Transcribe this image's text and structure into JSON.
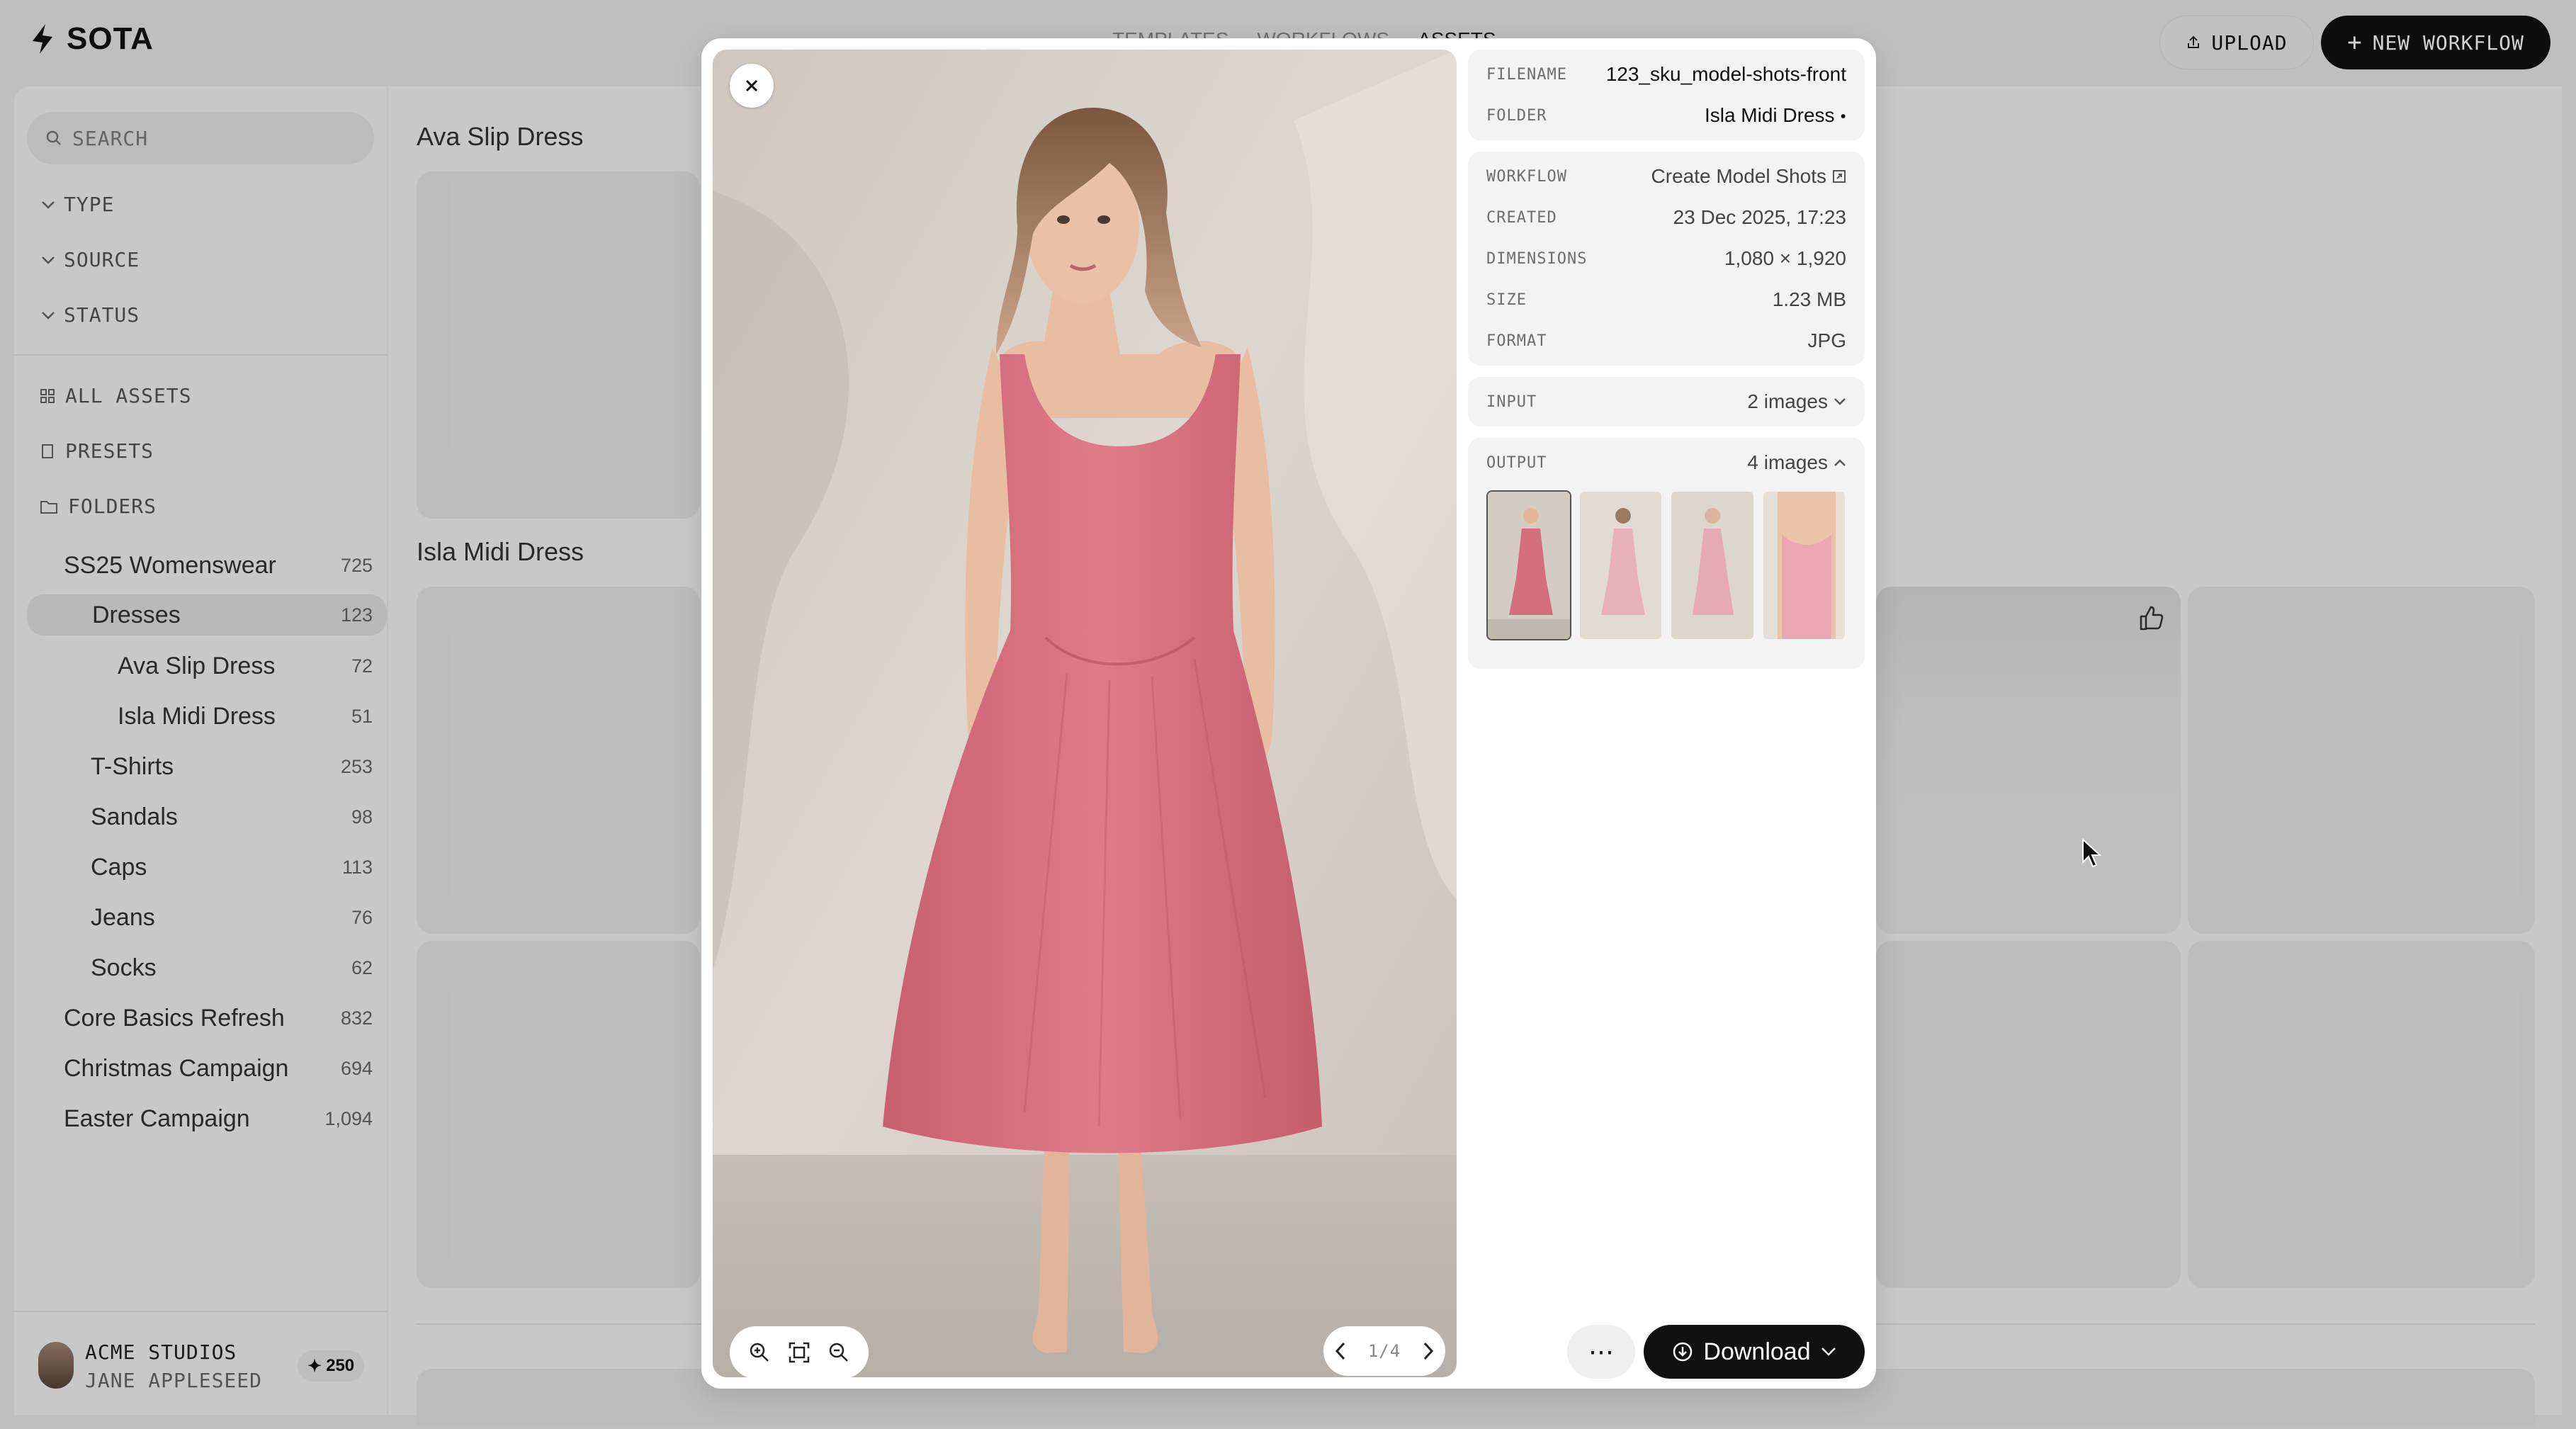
{
  "app": {
    "name": "SOTA"
  },
  "topnav": {
    "items": [
      "TEMPLATES",
      "WORKFLOWS",
      "ASSETS"
    ]
  },
  "header": {
    "upload_label": "UPLOAD",
    "new_workflow_label": "NEW WORKFLOW"
  },
  "sidebar": {
    "search_placeholder": "SEARCH",
    "filters": [
      "TYPE",
      "SOURCE",
      "STATUS"
    ],
    "links": {
      "all_assets": "ALL ASSETS",
      "presets": "PRESETS",
      "folders": "FOLDERS"
    },
    "folders": [
      {
        "label": "SS25 Womenswear",
        "count": "725"
      },
      {
        "label": "Dresses",
        "count": "123"
      },
      {
        "label": "Ava Slip Dress",
        "count": "72"
      },
      {
        "label": "Isla Midi Dress",
        "count": "51"
      },
      {
        "label": "T-Shirts",
        "count": "253"
      },
      {
        "label": "Sandals",
        "count": "98"
      },
      {
        "label": "Caps",
        "count": "113"
      },
      {
        "label": "Jeans",
        "count": "76"
      },
      {
        "label": "Socks",
        "count": "62"
      },
      {
        "label": "Core Basics Refresh",
        "count": "832"
      },
      {
        "label": "Christmas Campaign",
        "count": "694"
      },
      {
        "label": "Easter Campaign",
        "count": "1,094"
      }
    ],
    "account": {
      "org": "ACME STUDIOS",
      "user": "JANE APPLESEED",
      "credits": "250"
    }
  },
  "main": {
    "sections": [
      "Ava Slip Dress",
      "Isla Midi Dress"
    ]
  },
  "viewer": {
    "pager": "1/4",
    "details": {
      "filename_label": "FILENAME",
      "filename": "123_sku_model-shots-front",
      "folder_label": "FOLDER",
      "folder": "Isla Midi Dress",
      "workflow_label": "WORKFLOW",
      "workflow": "Create Model Shots",
      "created_label": "CREATED",
      "created": "23 Dec 2025, 17:23",
      "dimensions_label": "DIMENSIONS",
      "dimensions": "1,080 × 1,920",
      "size_label": "SIZE",
      "size": "1.23 MB",
      "format_label": "FORMAT",
      "format": "JPG",
      "input_label": "INPUT",
      "input": "2 images",
      "output_label": "OUTPUT",
      "output": "4 images"
    },
    "download_label": "Download",
    "colors": {
      "dress": "#d9717f",
      "wall": "#d7d1c9"
    }
  }
}
